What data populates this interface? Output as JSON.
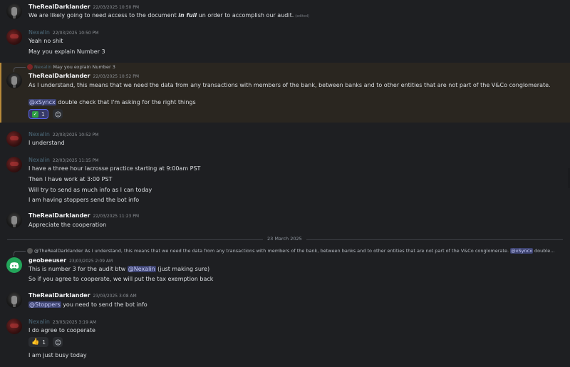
{
  "messages": [
    {
      "author": "TheRealDarklander",
      "ts": "22/03/2025 10:50 PM",
      "lines": [
        "We are likely going to need access to the document ",
        "in full",
        " un order to accomplish our audit."
      ],
      "edited": "(edited)"
    },
    {
      "author": "Nexalin",
      "ts": "22/03/2025 10:50 PM",
      "lines": [
        "Yeah no shit",
        "May you explain Number 3"
      ]
    },
    {
      "reply_to": "May you explain Number 3",
      "author": "TheRealDarklander",
      "ts": "22/03/2025 10:52 PM",
      "lines": [
        "As I understand, this means that we need the data from any transactions with members of the bank, between banks and to other entities that are not part of the V&Co conglomerate."
      ],
      "mention": "@xSyncx",
      "mention_rest": " double check that I'm asking for the right things",
      "reaction_count": "1"
    },
    {
      "author": "Nexalin",
      "ts": "22/03/2025 10:52 PM",
      "lines": [
        "I understand"
      ]
    },
    {
      "author": "Nexalin",
      "ts": "22/03/2025 11:15 PM",
      "lines": [
        "I have a three hour lacrosse practice starting at 9:00am PST",
        "Then I have work at 3:00 PST",
        "Will try to send as much info as I can today",
        "I am having stoppers send the bot info"
      ]
    },
    {
      "author": "TheRealDarklander",
      "ts": "22/03/2025 11:23 PM",
      "lines": [
        "Appreciate the cooperation"
      ]
    },
    {
      "reply_author": "@TheRealDarklander",
      "reply_text": " As I understand, this means that we need the data from any transactions with members of the bank, between banks and to other entities that are not part of the V&Co conglomerate.",
      "reply_mention": "@xSyncx",
      "reply_tail": " double...",
      "author": "geobeeuser",
      "ts": "23/03/2025 2:09 AM",
      "line1_pre": "This is number 3 for the audit btw ",
      "line1_mention": "@Nexalin",
      "line1_post": " (just making sure)",
      "line2": "So if you agree to cooperate, we will put the tax exemption back"
    },
    {
      "author": "TheRealDarklander",
      "ts": "23/03/2025 3:08 AM",
      "mention": "@Stoppers",
      "mention_rest": " you need to send the bot info"
    },
    {
      "author": "Nexalin",
      "ts": "23/03/2025 3:19 AM",
      "lines": [
        "I do agree to cooperate",
        "I am just busy today"
      ],
      "reaction_count": "1"
    }
  ],
  "divider": "23 March 2025",
  "icons": {
    "add_reaction": "smiley-icon",
    "check": "check-emoji",
    "thumb": "thumbs-up-emoji",
    "bot": "discord-icon"
  },
  "colors": {
    "accent": "#5865f2",
    "highlight_border": "#b8893a",
    "background": "#1e1f22"
  }
}
